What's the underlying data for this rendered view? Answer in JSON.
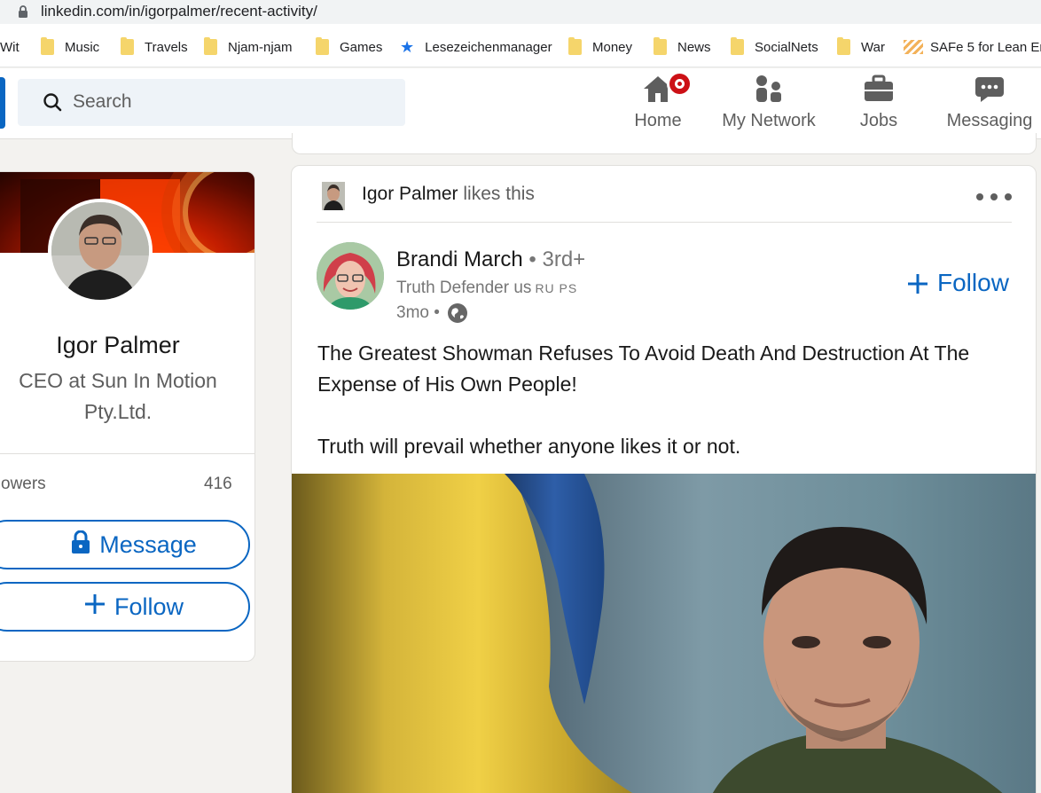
{
  "browser": {
    "url": "linkedin.com/in/igorpalmer/recent-activity/",
    "bookmarks": [
      {
        "label": "Wit",
        "icon": "folder-icon"
      },
      {
        "label": "Music",
        "icon": "folder-icon"
      },
      {
        "label": "Travels",
        "icon": "folder-icon"
      },
      {
        "label": "Njam-njam",
        "icon": "folder-icon"
      },
      {
        "label": "Games",
        "icon": "folder-icon"
      },
      {
        "label": "Lesezeichenmanager",
        "icon": "star-icon"
      },
      {
        "label": "Money",
        "icon": "folder-icon"
      },
      {
        "label": "News",
        "icon": "folder-icon"
      },
      {
        "label": "SocialNets",
        "icon": "folder-icon"
      },
      {
        "label": "War",
        "icon": "folder-icon"
      },
      {
        "label": "SAFe 5 for Lean Ent",
        "icon": "safe-icon"
      }
    ]
  },
  "header": {
    "search_placeholder": "Search",
    "nav": [
      {
        "label": "Home",
        "icon": "home-icon"
      },
      {
        "label": "My Network",
        "icon": "network-icon"
      },
      {
        "label": "Jobs",
        "icon": "briefcase-icon"
      },
      {
        "label": "Messaging",
        "icon": "messaging-icon"
      }
    ]
  },
  "profile": {
    "name": "Igor Palmer",
    "headline": "CEO at Sun In Motion Pty.Ltd.",
    "followers_label": "owers",
    "followers_count": "416",
    "message_label": "Message",
    "follow_label": "Follow"
  },
  "post": {
    "actor_name": "Igor Palmer",
    "actor_action": "likes this",
    "author_name": "Brandi March",
    "author_degree": "• 3rd+",
    "author_title": "Truth Defender us",
    "author_title_small": "RU PS",
    "time": "3mo •",
    "follow_label": "Follow",
    "text_1": "The Greatest Showman Refuses To Avoid Death And Destruction At The Expense of His Own People!",
    "text_2": "Truth will prevail whether anyone likes it or not."
  },
  "colors": {
    "accent": "#0a66c2",
    "badge": "#cc1016",
    "background": "#f3f2ef"
  }
}
